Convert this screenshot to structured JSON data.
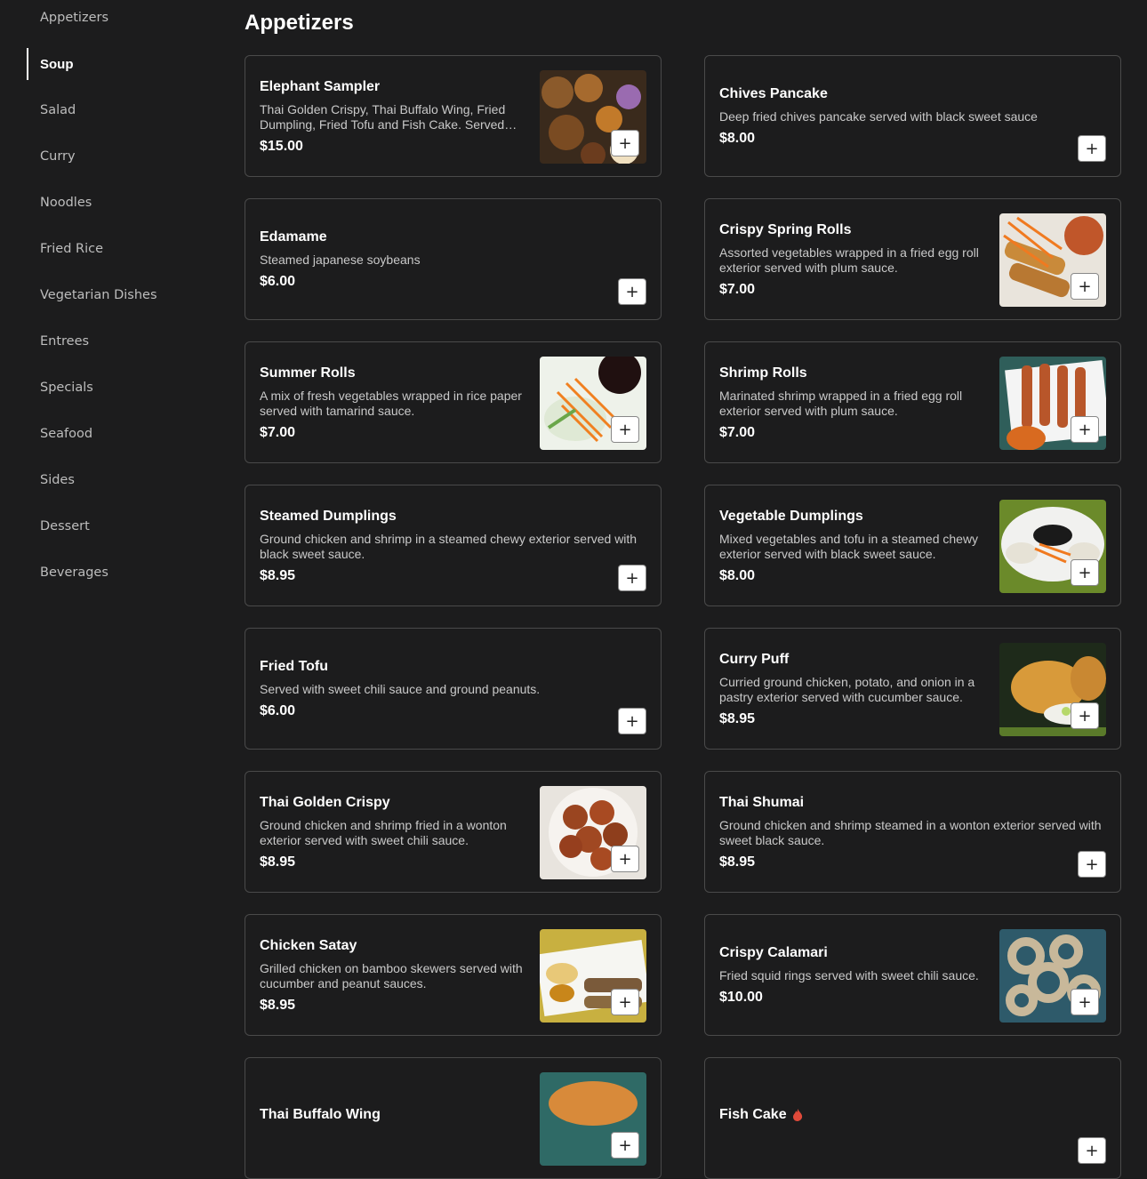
{
  "sidebar": {
    "items": [
      {
        "label": "Appetizers"
      },
      {
        "label": "Soup",
        "active": true
      },
      {
        "label": "Salad"
      },
      {
        "label": "Curry"
      },
      {
        "label": "Noodles"
      },
      {
        "label": "Fried Rice"
      },
      {
        "label": "Vegetarian Dishes"
      },
      {
        "label": "Entrees"
      },
      {
        "label": "Specials"
      },
      {
        "label": "Seafood"
      },
      {
        "label": "Sides"
      },
      {
        "label": "Dessert"
      },
      {
        "label": "Beverages"
      }
    ]
  },
  "section": {
    "title": "Appetizers"
  },
  "add_button_glyph": "+",
  "items": [
    {
      "name": "Elephant Sampler",
      "desc": "Thai Golden Crispy, Thai Buffalo Wing, Fried Dumpling, Fried Tofu and Fish Cake. Served with sweet chili sauce.",
      "price": "$15.00",
      "image": "fried-sampler"
    },
    {
      "name": "Chives Pancake",
      "desc": "Deep fried chives pancake served with black sweet sauce",
      "price": "$8.00"
    },
    {
      "name": "Edamame",
      "desc": "Steamed japanese soybeans",
      "price": "$6.00"
    },
    {
      "name": "Crispy Spring Rolls",
      "desc": "Assorted vegetables wrapped in a fried egg roll exterior served with plum sauce.",
      "price": "$7.00",
      "image": "spring-rolls"
    },
    {
      "name": "Summer Rolls",
      "desc": "A mix of fresh vegetables wrapped in rice paper served with tamarind sauce.",
      "price": "$7.00",
      "image": "summer-rolls"
    },
    {
      "name": "Shrimp Rolls",
      "desc": "Marinated shrimp wrapped in a fried egg roll exterior served with plum sauce.",
      "price": "$7.00",
      "image": "shrimp-rolls"
    },
    {
      "name": "Steamed Dumplings",
      "desc": "Ground chicken and shrimp in a steamed chewy exterior served with black sweet sauce.",
      "price": "$8.95"
    },
    {
      "name": "Vegetable Dumplings",
      "desc": "Mixed vegetables and tofu in a steamed chewy exterior served with black sweet sauce.",
      "price": "$8.00",
      "image": "veg-dumplings"
    },
    {
      "name": "Fried Tofu",
      "desc": "Served with sweet chili sauce and ground peanuts.",
      "price": "$6.00"
    },
    {
      "name": "Curry Puff",
      "desc": "Curried ground chicken, potato, and onion in a pastry exterior served with cucumber sauce.",
      "price": "$8.95",
      "image": "curry-puff"
    },
    {
      "name": "Thai Golden Crispy",
      "desc": "Ground chicken and shrimp fried in a wonton exterior served with sweet chili sauce.",
      "price": "$8.95",
      "image": "golden-crispy"
    },
    {
      "name": "Thai Shumai",
      "desc": "Ground chicken and shrimp steamed in a wonton exterior served with sweet black sauce.",
      "price": "$8.95"
    },
    {
      "name": "Chicken Satay",
      "desc": "Grilled chicken on bamboo skewers served with cucumber and peanut sauces.",
      "price": "$8.95",
      "image": "chicken-satay"
    },
    {
      "name": "Crispy Calamari",
      "desc": "Fried squid rings served with sweet chili sauce.",
      "price": "$10.00",
      "image": "calamari"
    },
    {
      "name": "Thai Buffalo Wing",
      "desc": "",
      "price": "",
      "image": "buffalo-wing"
    },
    {
      "name": "Fish Cake",
      "desc": "",
      "price": "",
      "spicy": true
    }
  ]
}
